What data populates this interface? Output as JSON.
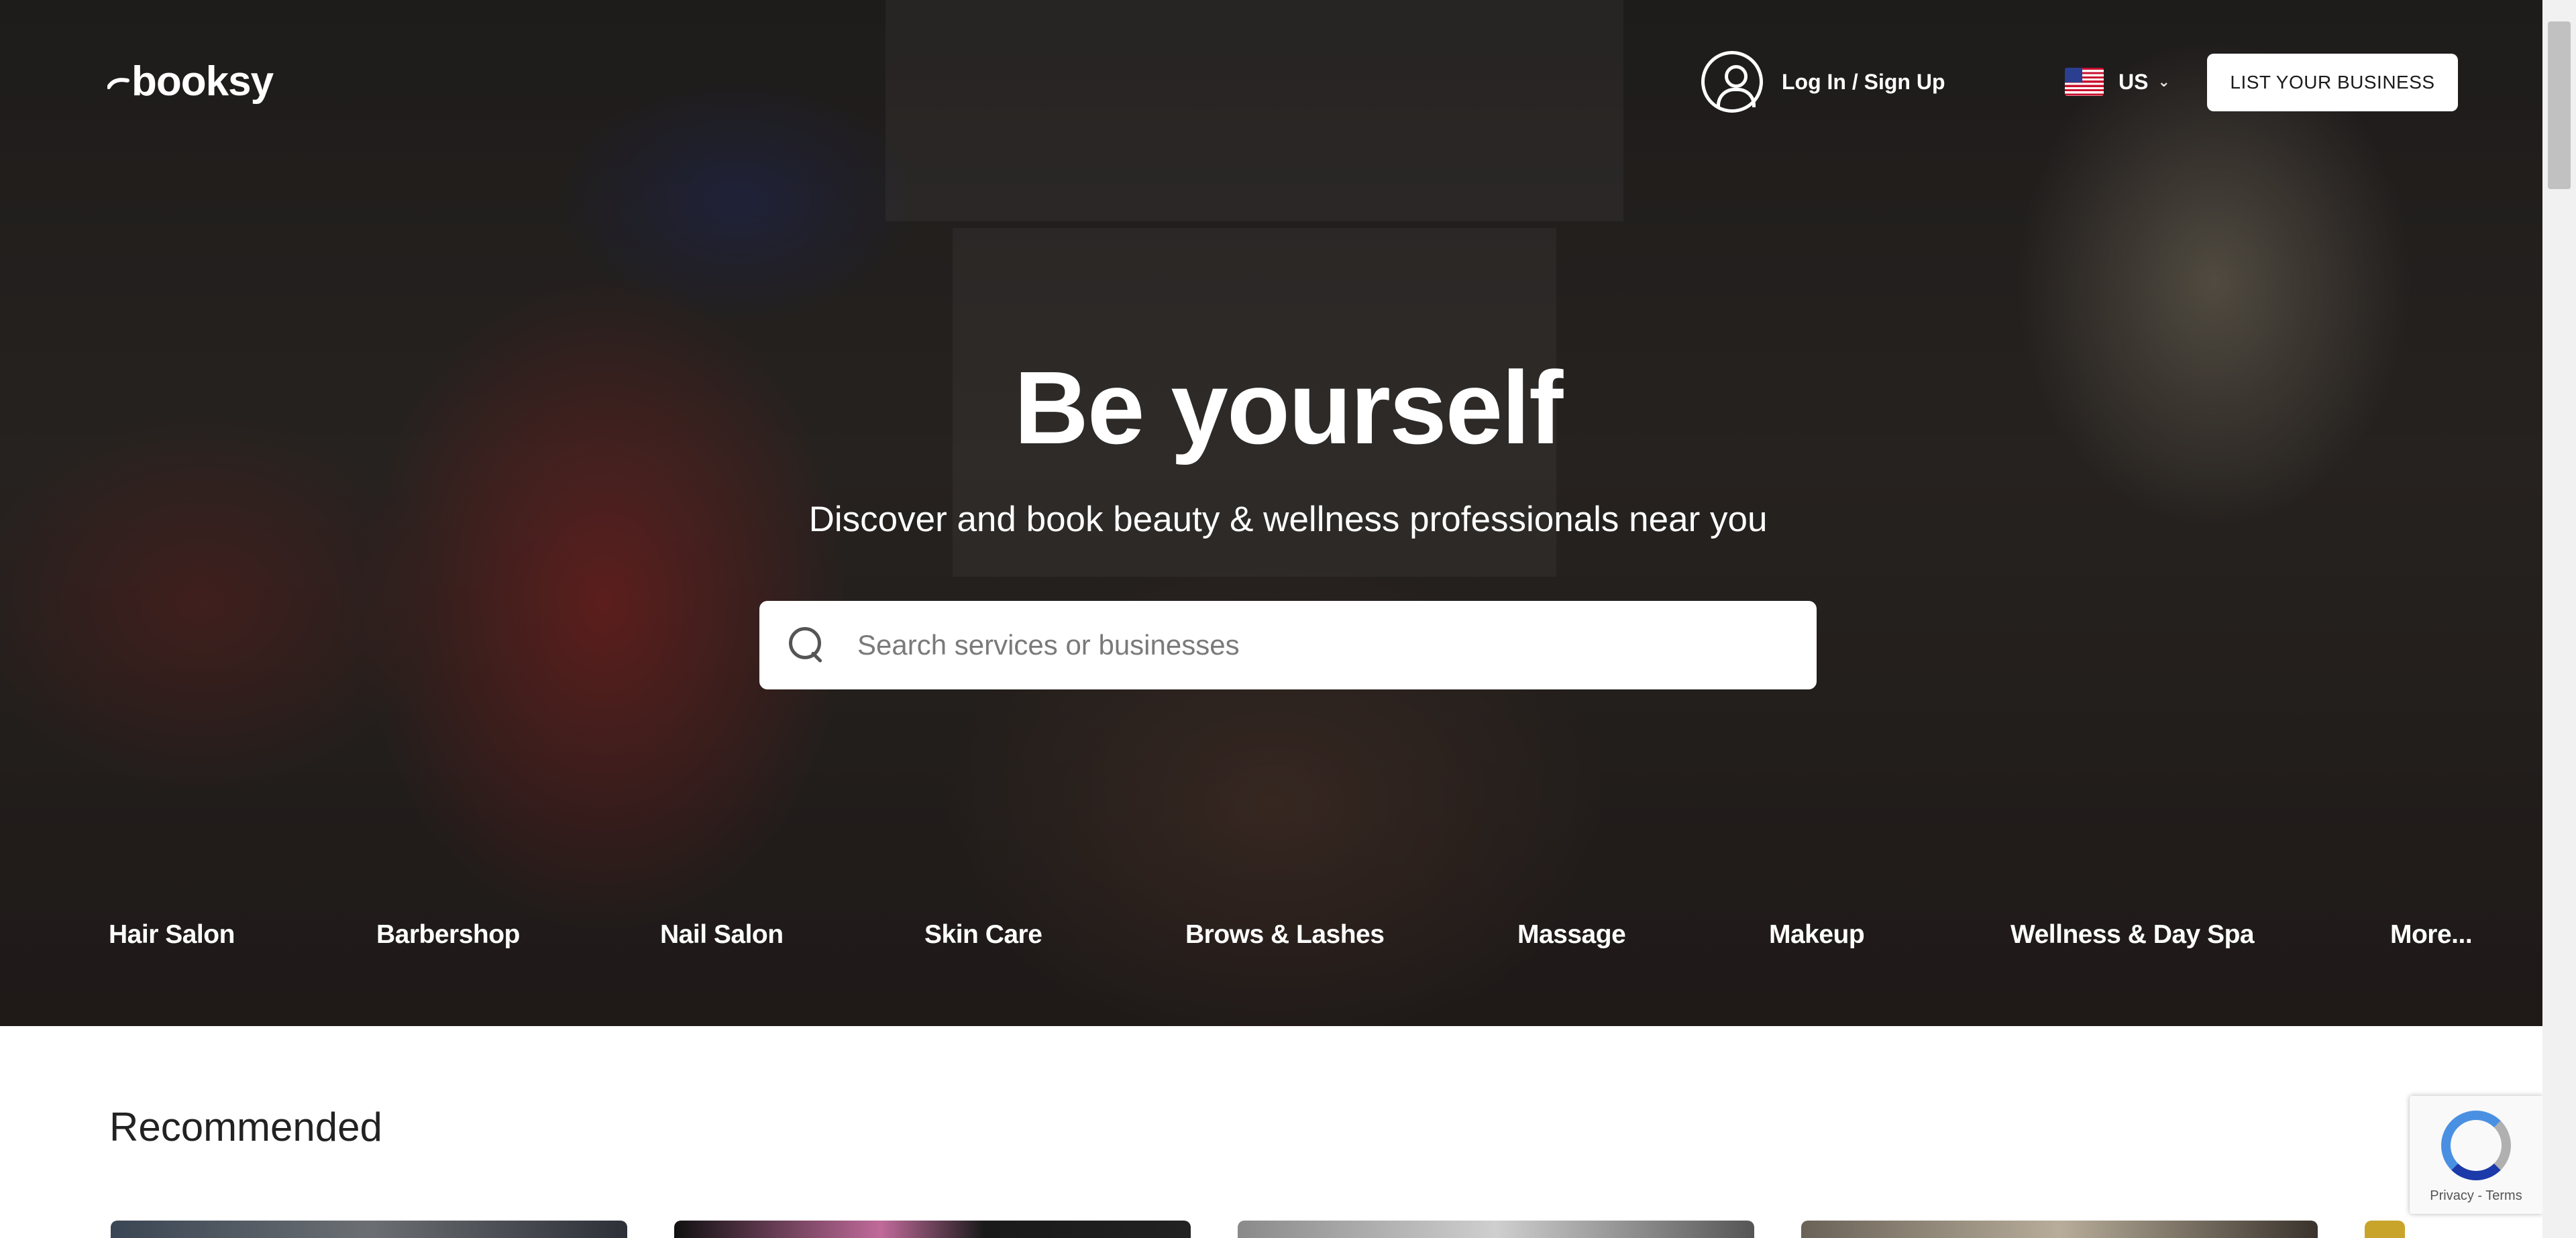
{
  "header": {
    "logo_text": "booksy",
    "login_label": "Log In / Sign Up",
    "locale_label": "US",
    "list_business_label": "LIST YOUR BUSINESS"
  },
  "hero": {
    "headline": "Be yourself",
    "subline": "Discover and book beauty & wellness professionals near you",
    "search": {
      "placeholder": "Search services or businesses",
      "icon": "search-icon"
    }
  },
  "categories": [
    "Hair Salon",
    "Barbershop",
    "Nail Salon",
    "Skin Care",
    "Brows & Lashes",
    "Massage",
    "Makeup",
    "Wellness & Day Spa",
    "More..."
  ],
  "recommended": {
    "title": "Recommended"
  },
  "recaptcha": {
    "links": "Privacy - Terms"
  },
  "colors": {
    "accent_button_bg": "#ffffff",
    "hero_text": "#ffffff",
    "page_bg": "#ffffff"
  }
}
